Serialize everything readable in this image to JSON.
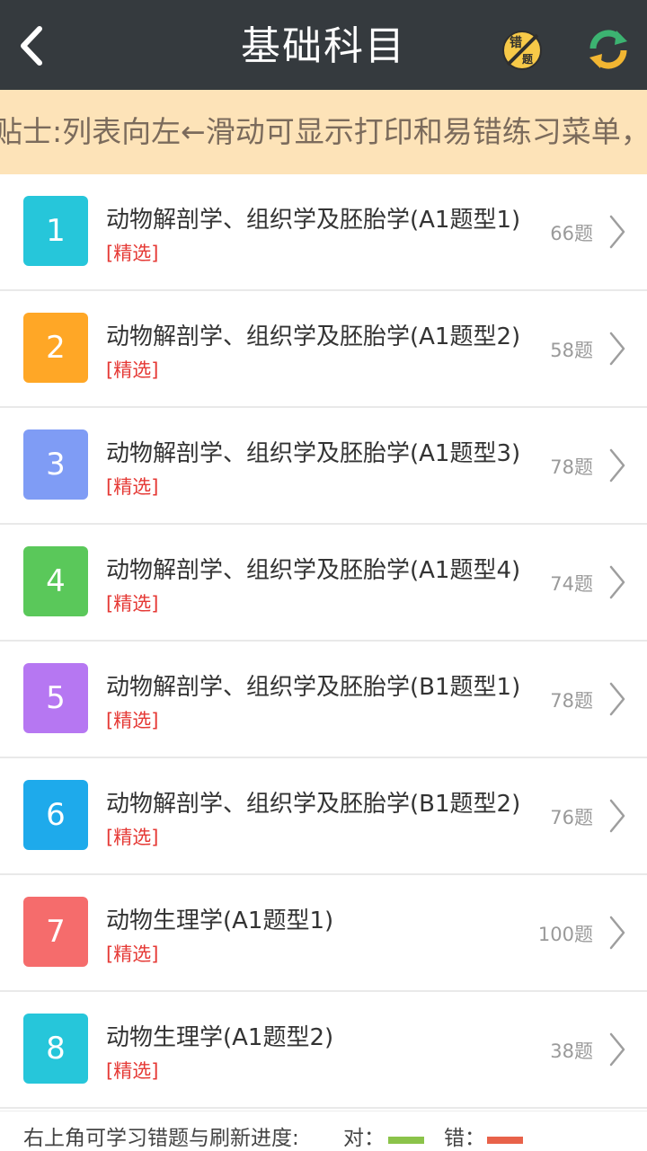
{
  "header": {
    "title": "基础科目",
    "back_icon": "chevron-left-icon",
    "wrong_icon_text": "错题",
    "refresh_icon": "refresh-icon"
  },
  "tip": {
    "text": "贴士:列表向左←滑动可显示打印和易错练习菜单，长"
  },
  "items": [
    {
      "num": "1",
      "color": "#26c6da",
      "title": "动物解剖学、组织学及胚胎学(A1题型1)",
      "tag": "[精选]",
      "count": "66题"
    },
    {
      "num": "2",
      "color": "#ffa726",
      "title": "动物解剖学、组织学及胚胎学(A1题型2)",
      "tag": "[精选]",
      "count": "58题"
    },
    {
      "num": "3",
      "color": "#7f9cf5",
      "title": "动物解剖学、组织学及胚胎学(A1题型3)",
      "tag": "[精选]",
      "count": "78题"
    },
    {
      "num": "4",
      "color": "#5ac85a",
      "title": "动物解剖学、组织学及胚胎学(A1题型4)",
      "tag": "[精选]",
      "count": "74题"
    },
    {
      "num": "5",
      "color": "#b677f2",
      "title": "动物解剖学、组织学及胚胎学(B1题型1)",
      "tag": "[精选]",
      "count": "78题"
    },
    {
      "num": "6",
      "color": "#1eaaeb",
      "title": "动物解剖学、组织学及胚胎学(B1题型2)",
      "tag": "[精选]",
      "count": "76题"
    },
    {
      "num": "7",
      "color": "#f56c6c",
      "title": "动物生理学(A1题型1)",
      "tag": "[精选]",
      "count": "100题"
    },
    {
      "num": "8",
      "color": "#26c6da",
      "title": "动物生理学(A1题型2)",
      "tag": "[精选]",
      "count": "38题"
    }
  ],
  "footer": {
    "text": "右上角可学习错题与刷新进度:",
    "correct_label": "对：",
    "correct_color": "#8bc34a",
    "wrong_label": "错：",
    "wrong_color": "#e8624a"
  }
}
